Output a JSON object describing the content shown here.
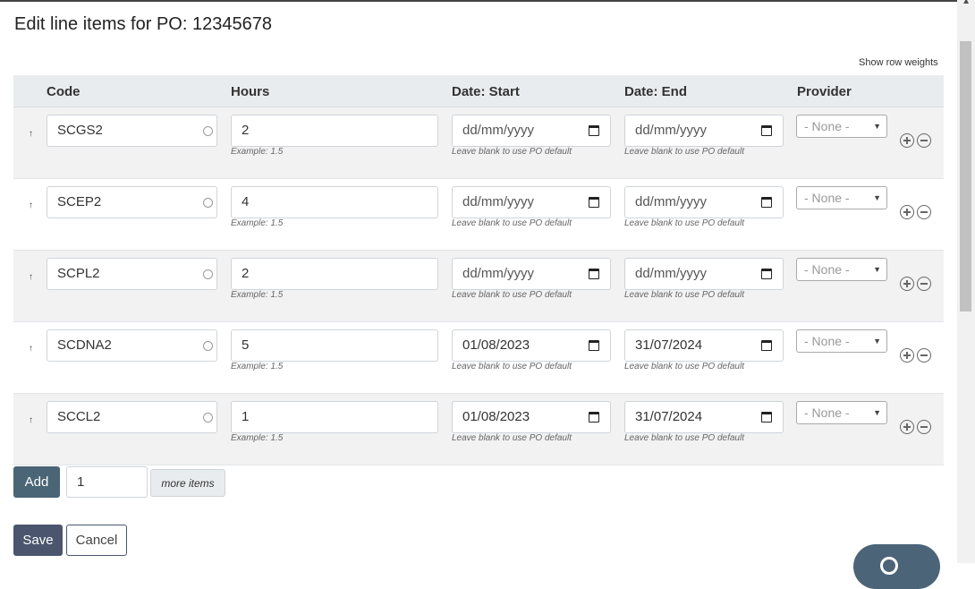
{
  "dialog": {
    "title": "Edit line items for PO: 12345678",
    "show_row_weights": "Show row weights"
  },
  "columns": [
    "Code",
    "Hours",
    "Date: Start",
    "Date: End",
    "Provider"
  ],
  "rows": [
    {
      "code": "SCGS2",
      "hours": "2",
      "hours_hint": "Example: 1.5",
      "start": "dd/mm/yyyy",
      "start_hint": "Leave blank to use PO default",
      "end": "dd/mm/yyyy",
      "end_hint": "Leave blank to use PO default",
      "provider": "- None -"
    },
    {
      "code": "SCEP2",
      "hours": "4",
      "hours_hint": "Example: 1.5",
      "start": "dd/mm/yyyy",
      "start_hint": "Leave blank to use PO default",
      "end": "dd/mm/yyyy",
      "end_hint": "Leave blank to use PO default",
      "provider": "- None -"
    },
    {
      "code": "SCPL2",
      "hours": "2",
      "hours_hint": "Example: 1.5",
      "start": "dd/mm/yyyy",
      "start_hint": "Leave blank to use PO default",
      "end": "dd/mm/yyyy",
      "end_hint": "Leave blank to use PO default",
      "provider": "- None -"
    },
    {
      "code": "SCDNA2",
      "hours": "5",
      "hours_hint": "Example: 1.5",
      "start": "01/08/2023",
      "start_hint": "Leave blank to use PO default",
      "end": "31/07/2024",
      "end_hint": "Leave blank to use PO default",
      "provider": "- None -"
    },
    {
      "code": "SCCL2",
      "hours": "1",
      "hours_hint": "Example: 1.5",
      "start": "01/08/2023",
      "start_hint": "Leave blank to use PO default",
      "end": "31/07/2024",
      "end_hint": "Leave blank to use PO default",
      "provider": "- None -"
    }
  ],
  "footer": {
    "add_label": "Add",
    "add_count": "1",
    "more_items": "more items",
    "save_label": "Save",
    "cancel_label": "Cancel"
  },
  "icons": {
    "drag_handle": "drag-handle-icon",
    "code_status": "circle-icon",
    "calendar": "calendar-icon",
    "add_row": "plus-circle-icon",
    "remove_row": "minus-circle-icon",
    "dropdown": "chevron-down-icon",
    "help": "help-icon"
  },
  "colors": {
    "primary_button": "#4a6575",
    "save_button": "#4b566e",
    "header_bg": "#e9ecef"
  }
}
